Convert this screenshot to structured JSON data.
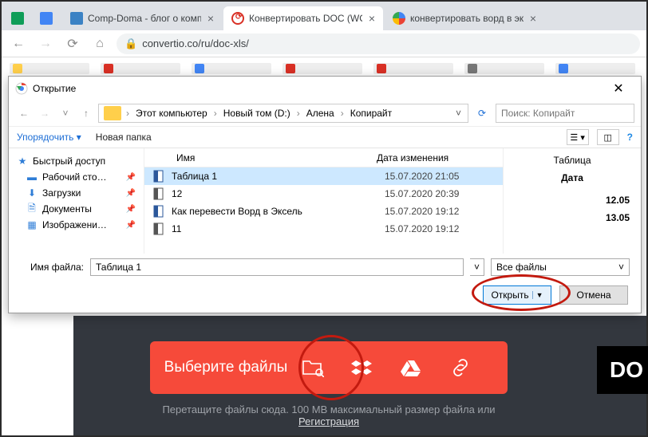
{
  "browser": {
    "tabs": [
      {
        "label": "",
        "color": "#0f9d58"
      },
      {
        "label": "",
        "color": "#4285f4"
      },
      {
        "label": "Comp-Doma - блог о компьюте",
        "color": "#3b82c4"
      },
      {
        "label": "Конвертировать DOC (WORD) в",
        "color": "#d93025",
        "active": true
      },
      {
        "label": "конвертировать ворд в эксель ",
        "color": "#4285f4"
      }
    ],
    "url": "convertio.co/ru/doc-xls/"
  },
  "dialog": {
    "title": "Открытие",
    "breadcrumb": [
      "Этот компьютер",
      "Новый том (D:)",
      "Алена",
      "Копирайт"
    ],
    "search_placeholder": "Поиск: Копирайт",
    "toolbar": {
      "organize": "Упорядочить",
      "new_folder": "Новая папка"
    },
    "columns": {
      "name": "Имя",
      "date": "Дата изменения"
    },
    "sidebar": {
      "quick": "Быстрый доступ",
      "items": [
        {
          "label": "Рабочий сто…",
          "icon": "desktop"
        },
        {
          "label": "Загрузки",
          "icon": "download"
        },
        {
          "label": "Документы",
          "icon": "doc"
        },
        {
          "label": "Изображени…",
          "icon": "pic"
        }
      ]
    },
    "files": [
      {
        "name": "Таблица 1",
        "date": "15.07.2020 21:05",
        "type": "word",
        "selected": true
      },
      {
        "name": "12",
        "date": "15.07.2020 20:39",
        "type": "doc"
      },
      {
        "name": "Как перевести Ворд в Эксель",
        "date": "15.07.2020 19:12",
        "type": "word"
      },
      {
        "name": "11",
        "date": "15.07.2020 19:12",
        "type": "doc"
      }
    ],
    "preview": {
      "name": "Таблица",
      "label": "Дата",
      "rows": [
        "12.05",
        "13.05"
      ]
    },
    "filename_label": "Имя файла:",
    "filename_value": "Таблица 1",
    "filter": "Все файлы",
    "open": "Открыть",
    "cancel": "Отмена"
  },
  "page": {
    "select_label": "Выберите файлы",
    "hint_prefix": "Перетащите файлы сюда. 100 MB максимальный размер файла или ",
    "hint_link": "Регистрация",
    "do": "DO"
  }
}
